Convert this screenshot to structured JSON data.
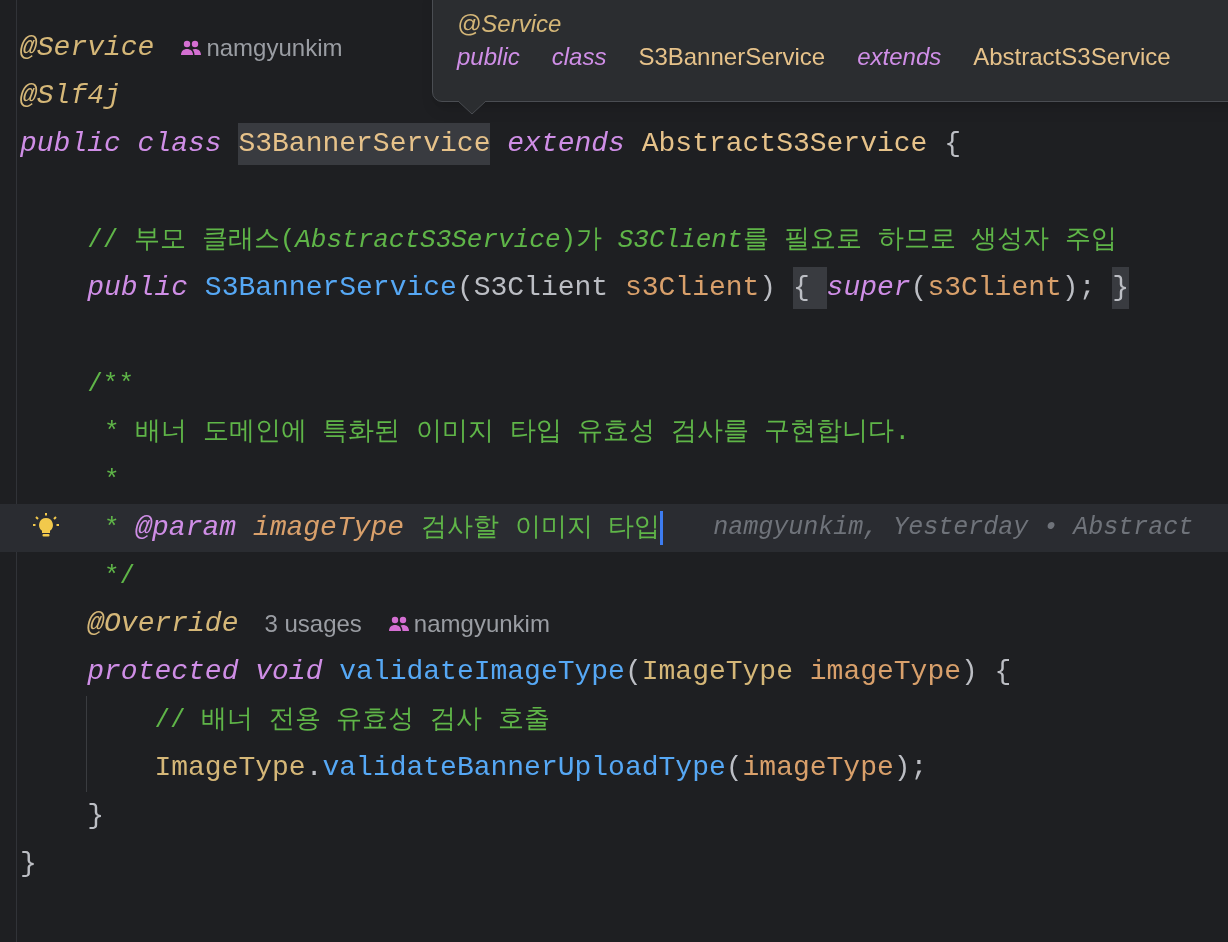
{
  "tooltip": {
    "annotation": "@Service",
    "signature": [
      {
        "kind": "keyword",
        "text": "public"
      },
      {
        "kind": "keyword",
        "text": "class"
      },
      {
        "kind": "class",
        "text": "S3BannerService"
      },
      {
        "kind": "keyword",
        "text": "extends"
      },
      {
        "kind": "class",
        "text": "AbstractS3Service"
      }
    ]
  },
  "lines": [
    {
      "kind": "code",
      "current": false,
      "segments": [
        {
          "kind": "annotation",
          "text": "@Service"
        },
        {
          "kind": "author",
          "text": "namgyunkim"
        }
      ]
    },
    {
      "kind": "code",
      "current": false,
      "segments": [
        {
          "kind": "annotation",
          "text": "@Slf4j"
        }
      ]
    },
    {
      "kind": "code",
      "current": false,
      "segments": [
        {
          "kind": "keyword",
          "text": "public class "
        },
        {
          "kind": "highlight",
          "text": "S3BannerService"
        },
        {
          "kind": "keyword",
          "text": " extends "
        },
        {
          "kind": "class",
          "text": "AbstractS3Service"
        },
        {
          "kind": "plain",
          "text": " {"
        }
      ]
    },
    {
      "kind": "blank",
      "current": false
    },
    {
      "kind": "code",
      "current": false,
      "segments": [
        {
          "kind": "comment",
          "text": "    // 부모 클래스("
        },
        {
          "kind": "comment_ref",
          "text": "AbstractS3Service"
        },
        {
          "kind": "comment",
          "text": ")가 "
        },
        {
          "kind": "comment_ref",
          "text": "S3Client"
        },
        {
          "kind": "comment",
          "text": "를 필요로 하므로 생성자 주입"
        }
      ]
    },
    {
      "kind": "code",
      "current": false,
      "segments": [
        {
          "kind": "keyword",
          "text": "    public "
        },
        {
          "kind": "method",
          "text": "S3BannerService"
        },
        {
          "kind": "plain",
          "text": "(S3Client "
        },
        {
          "kind": "param",
          "text": "s3Client"
        },
        {
          "kind": "plain",
          "text": ")"
        },
        {
          "kind": "fold",
          "text": " { "
        },
        {
          "kind": "keyword",
          "text": "super"
        },
        {
          "kind": "plain",
          "text": "("
        },
        {
          "kind": "param",
          "text": "s3Client"
        },
        {
          "kind": "plain",
          "text": ");"
        },
        {
          "kind": "fold",
          "text": " }"
        }
      ]
    },
    {
      "kind": "blank",
      "current": false
    },
    {
      "kind": "code",
      "current": false,
      "segments": [
        {
          "kind": "comment",
          "text": "    /**"
        }
      ]
    },
    {
      "kind": "code",
      "current": false,
      "segments": [
        {
          "kind": "comment",
          "text": "     * 배너 도메인에 특화된 이미지 타입 유효성 검사를 구현합니다."
        }
      ]
    },
    {
      "kind": "code",
      "current": false,
      "segments": [
        {
          "kind": "comment",
          "text": "     *"
        }
      ]
    },
    {
      "kind": "code",
      "current": true,
      "segments": [
        {
          "kind": "comment",
          "text": "     * "
        },
        {
          "kind": "doc_tag",
          "text": "@param"
        },
        {
          "kind": "doc_param",
          "text": " imageType"
        },
        {
          "kind": "comment",
          "text": " 검사할 이미지 타입"
        },
        {
          "kind": "caret"
        },
        {
          "kind": "blame",
          "text": "namgyunkim, Yesterday • Abstract"
        }
      ]
    },
    {
      "kind": "code",
      "current": false,
      "segments": [
        {
          "kind": "comment",
          "text": "     */"
        }
      ]
    },
    {
      "kind": "code",
      "current": false,
      "segments": [
        {
          "kind": "annotation",
          "text": "    @Override"
        },
        {
          "kind": "inlay",
          "text": "3 usages"
        },
        {
          "kind": "author",
          "text": "namgyunkim"
        }
      ]
    },
    {
      "kind": "code",
      "current": false,
      "segments": [
        {
          "kind": "keyword",
          "text": "    protected void "
        },
        {
          "kind": "method",
          "text": "validateImageType"
        },
        {
          "kind": "plain",
          "text": "("
        },
        {
          "kind": "enum",
          "text": "ImageType"
        },
        {
          "kind": "param",
          "text": " imageType"
        },
        {
          "kind": "plain",
          "text": ") {"
        }
      ]
    },
    {
      "kind": "code",
      "current": false,
      "segments": [
        {
          "kind": "comment",
          "text": "        // 배너 전용 유효성 검사 호출"
        }
      ]
    },
    {
      "kind": "code",
      "current": false,
      "segments": [
        {
          "kind": "enum",
          "text": "        ImageType"
        },
        {
          "kind": "plain",
          "text": "."
        },
        {
          "kind": "method",
          "text": "validateBannerUploadType"
        },
        {
          "kind": "plain",
          "text": "("
        },
        {
          "kind": "param",
          "text": "imageType"
        },
        {
          "kind": "plain",
          "text": ");"
        }
      ]
    },
    {
      "kind": "code",
      "current": false,
      "segments": [
        {
          "kind": "plain",
          "text": "    }"
        }
      ]
    },
    {
      "kind": "code",
      "current": false,
      "segments": [
        {
          "kind": "plain",
          "text": "}"
        }
      ]
    }
  ]
}
